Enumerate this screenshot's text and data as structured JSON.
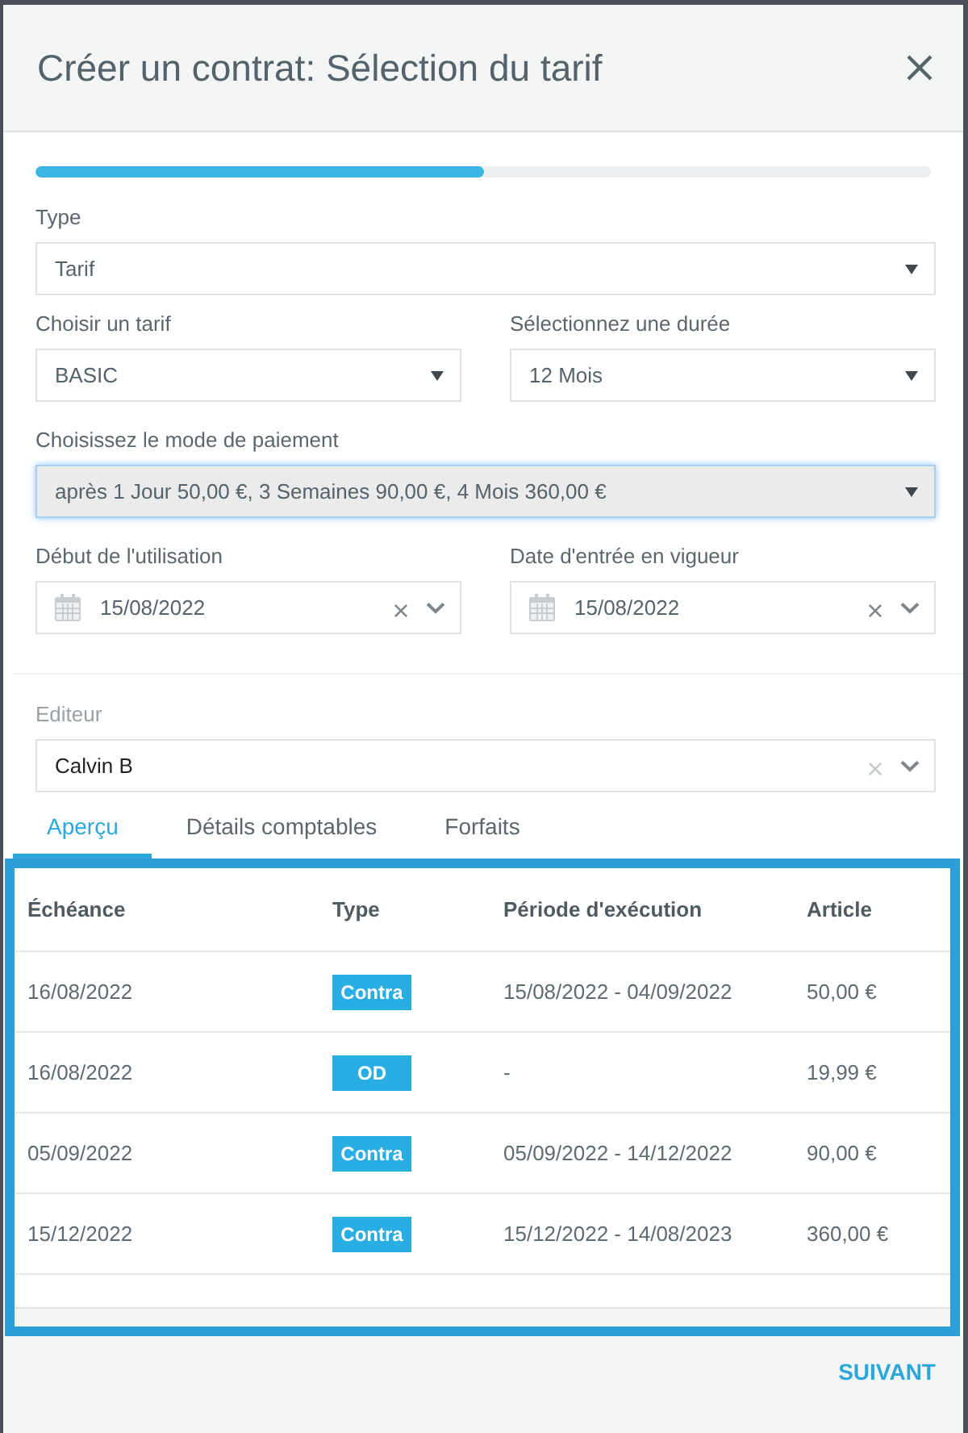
{
  "dialog": {
    "title": "Créer un contrat: Sélection du tarif"
  },
  "progress": {
    "level": 0.5
  },
  "form_sections": [
    {
      "rows": [
        {
          "fields": [
            {
              "kind": "select",
              "label": "Type",
              "value": "Tarif",
              "focused": false
            }
          ]
        },
        {
          "fields": [
            {
              "kind": "select",
              "label": "Choisir un tarif",
              "value": "BASIC",
              "focused": false
            },
            {
              "kind": "select",
              "label": "Sélectionnez une durée",
              "value": "12 Mois",
              "focused": false
            }
          ]
        },
        {
          "fields": [
            {
              "kind": "select",
              "label": "Choisissez le mode de paiement",
              "value": "après 1 Jour 50,00 €, 3 Semaines 90,00 €, 4 Mois 360,00 €",
              "focused": true
            }
          ]
        },
        {
          "fields": [
            {
              "kind": "date",
              "label": "Début de l'utilisation",
              "value": "15/08/2022",
              "focused": false
            },
            {
              "kind": "date",
              "label": "Date d'entrée en vigueur",
              "value": "15/08/2022",
              "focused": false
            }
          ]
        }
      ]
    },
    {
      "rows": [
        {
          "fields": [
            {
              "kind": "combo",
              "label": "Editeur",
              "value": "Calvin B",
              "focused": false
            }
          ]
        }
      ]
    }
  ],
  "tabs": [
    {
      "label": "Aperçu",
      "selected": true
    },
    {
      "label": "Détails comptables",
      "selected": false
    },
    {
      "label": "Forfaits",
      "selected": false
    }
  ],
  "schedule_table": {
    "columns": [
      "Échéance",
      "Type",
      "Période d'exécution",
      "Article"
    ],
    "rows": [
      {
        "due_date": "16/08/2022",
        "type": "Contra",
        "period": "15/08/2022 - 04/09/2022",
        "amount": "50,00 €"
      },
      {
        "due_date": "16/08/2022",
        "type": "OD",
        "period": "-",
        "amount": "19,99 €"
      },
      {
        "due_date": "05/09/2022",
        "type": "Contra",
        "period": "05/09/2022 - 14/12/2022",
        "amount": "90,00 €"
      },
      {
        "due_date": "15/12/2022",
        "type": "Contra",
        "period": "15/12/2022 - 14/08/2023",
        "amount": "360,00 €"
      }
    ]
  },
  "footer": {
    "next_button": "SUIVANT"
  }
}
